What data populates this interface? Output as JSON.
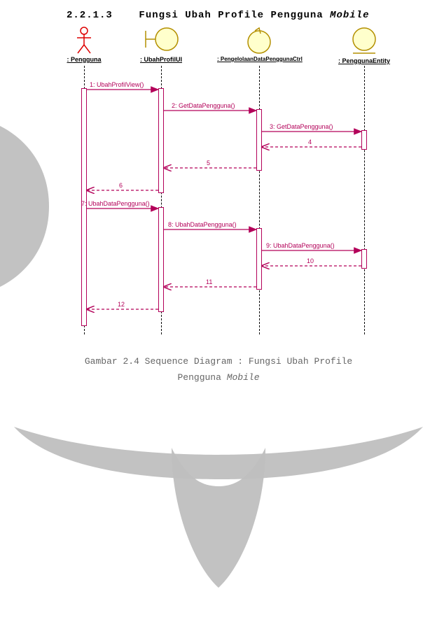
{
  "heading": {
    "number": "2.2.1.3",
    "text_a": "Fungsi Ubah Profile Pengguna ",
    "text_b": "Mobile"
  },
  "caption": {
    "line1_a": "Gambar 2.4 Sequence Diagram : Fungsi Ubah Profile",
    "line2_a": "Pengguna ",
    "line2_b": "Mobile"
  },
  "lifelines": {
    "pengguna": ": Pengguna",
    "ubahprofilui": ": UbahProfilUI",
    "ctrl": ": PengelolaanDataPenggunaCtrl",
    "entity": ": PenggunaEntity"
  },
  "messages": {
    "m1": "1: UbahProfilView()",
    "m2": "2: GetDataPengguna()",
    "m3": "3: GetDataPengguna()",
    "m4": "4",
    "m5": "5",
    "m6": "6",
    "m7": "7: UbahDataPengguna()",
    "m8": "8: UbahDataPengguna()",
    "m9": "9: UbahDataPengguna()",
    "m10": "10",
    "m11": "11",
    "m12": "12"
  }
}
